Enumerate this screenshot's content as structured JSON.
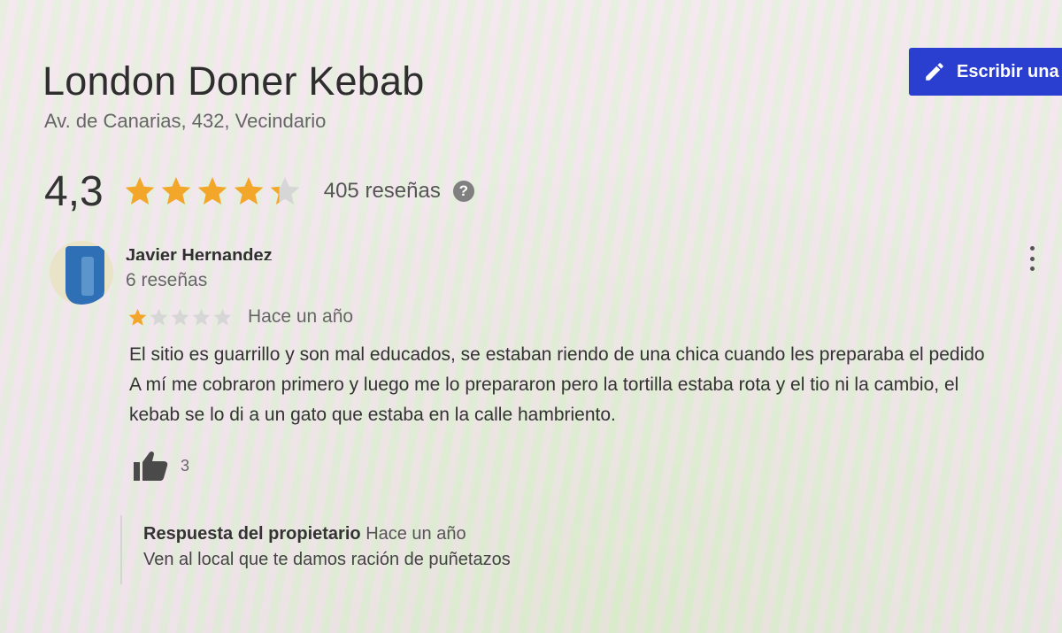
{
  "place": {
    "title": "London Doner Kebab",
    "address": "Av. de Canarias, 432, Vecindario"
  },
  "header": {
    "write_review_label": "Escribir una"
  },
  "rating": {
    "value": "4,3",
    "stars_numeric": 4.3,
    "review_count": "405 reseñas",
    "help_icon": "?"
  },
  "review": {
    "author": "Javier Hernandez",
    "author_reviews": "6 reseñas",
    "stars_numeric": 1,
    "time": "Hace un año",
    "lines": [
      "El sitio es guarrillo y son mal educados, se estaban riendo de una chica cuando les preparaba el pedido",
      "A mí me cobraron primero y luego me lo prepararon pero la tortilla estaba rota y el tio ni la cambio, el",
      "kebab se lo di a un gato que estaba en la calle hambriento."
    ],
    "likes": "3"
  },
  "owner_reply": {
    "label": "Respuesta del propietario",
    "time": "Hace un año",
    "text": "Ven al local que te damos ración de puñetazos"
  },
  "colors": {
    "star_filled": "#f2a72b",
    "star_empty": "#d6d6d6",
    "button_bg": "#2a3fd0"
  },
  "icons": {
    "write_review": "pencil-icon",
    "help": "help-icon",
    "more": "more-vert-icon",
    "like": "thumbs-up-icon"
  }
}
